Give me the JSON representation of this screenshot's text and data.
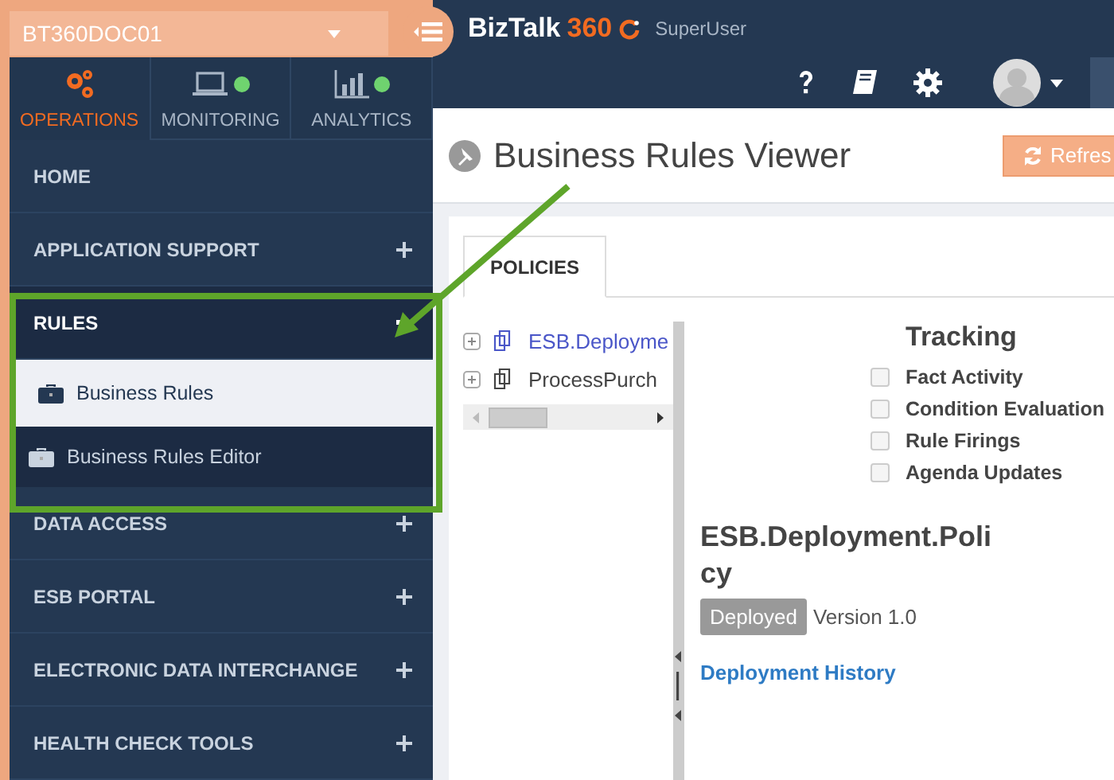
{
  "server_select": {
    "value": "BT360DOC01"
  },
  "brand": {
    "name": "BizTalk",
    "version": "360",
    "role": "SuperUser"
  },
  "nav_tabs": [
    {
      "label": "OPERATIONS",
      "selected": true,
      "kind": "gears"
    },
    {
      "label": "MONITORING",
      "selected": false,
      "kind": "laptop"
    },
    {
      "label": "ANALYTICS",
      "selected": false,
      "kind": "chart"
    }
  ],
  "menu": [
    {
      "label": "HOME",
      "kind": "link"
    },
    {
      "label": "APPLICATION SUPPORT",
      "kind": "group",
      "expanded": false
    },
    {
      "label": "RULES",
      "kind": "group",
      "expanded": true,
      "children": [
        {
          "label": "Business Rules",
          "selected": true
        },
        {
          "label": "Business Rules Editor",
          "selected": false
        }
      ]
    },
    {
      "label": "DATA ACCESS",
      "kind": "group",
      "expanded": false
    },
    {
      "label": "ESB PORTAL",
      "kind": "group",
      "expanded": false
    },
    {
      "label": "ELECTRONIC DATA INTERCHANGE",
      "kind": "group",
      "expanded": false
    },
    {
      "label": "HEALTH CHECK TOOLS",
      "kind": "group",
      "expanded": false
    }
  ],
  "page_title": "Business Rules Viewer",
  "refresh_button": "Refres",
  "tabs": [
    {
      "label": "POLICIES",
      "selected": true
    }
  ],
  "policies": [
    {
      "name": "ESB.Deployme",
      "selected": true
    },
    {
      "name": "ProcessPurch",
      "selected": false
    }
  ],
  "tracking": {
    "title": "Tracking",
    "options": [
      {
        "label": "Fact Activity",
        "checked": false
      },
      {
        "label": "Condition Evaluation",
        "checked": false
      },
      {
        "label": "Rule Firings",
        "checked": false
      },
      {
        "label": "Agenda Updates",
        "checked": false
      }
    ]
  },
  "policy": {
    "name": "ESB.Deployment.Policy",
    "status": "Deployed",
    "version": "Version 1.0",
    "history_link": "Deployment History"
  }
}
